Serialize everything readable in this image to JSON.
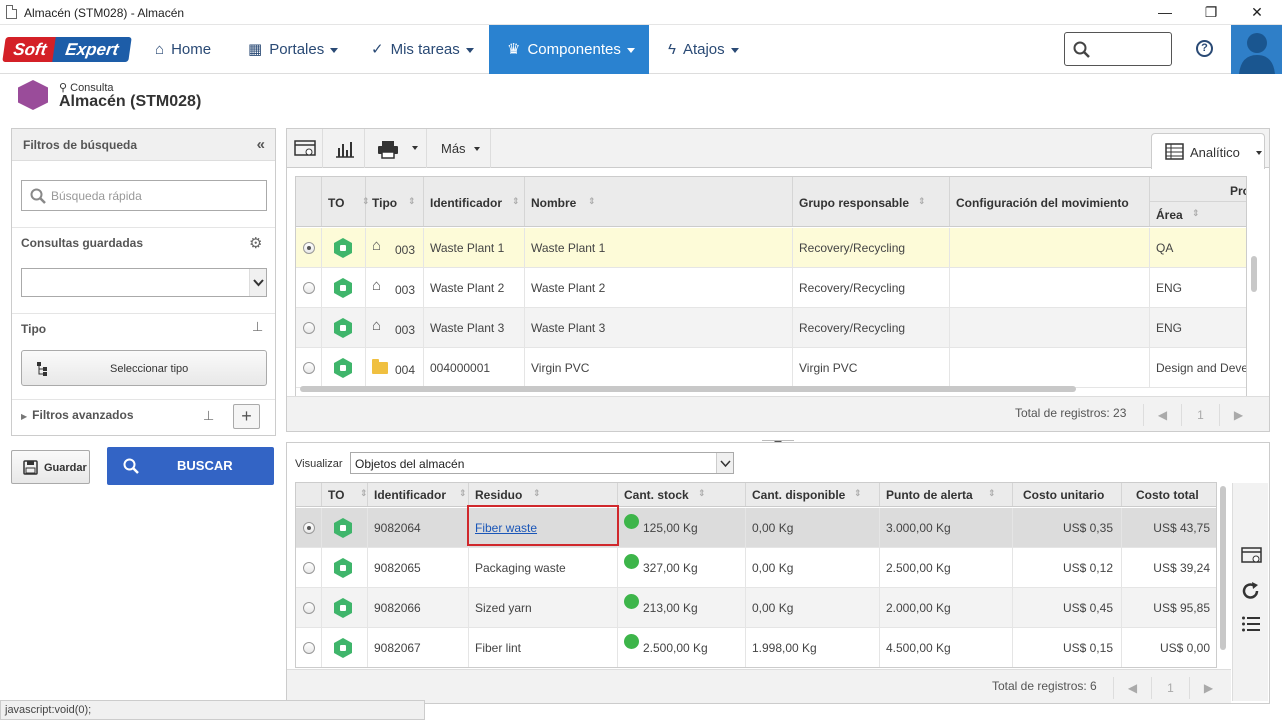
{
  "window": {
    "title": "Almacén (STM028) - Almacén",
    "min_glyph": "—",
    "max_glyph": "❐",
    "close_glyph": "✕"
  },
  "nav": {
    "logo_soft": "Soft",
    "logo_expert": "Expert",
    "items": [
      {
        "label": "Home",
        "icon": "home-icon"
      },
      {
        "label": "Portales",
        "icon": "grid-icon"
      },
      {
        "label": "Mis tareas",
        "icon": "check-icon"
      },
      {
        "label": "Componentes",
        "icon": "trophy-icon"
      },
      {
        "label": "Atajos",
        "icon": "bolt-icon"
      }
    ],
    "search_placeholder": "",
    "help_glyph": "?"
  },
  "page": {
    "subtitle": "Consulta",
    "title": "Almacén (STM028)"
  },
  "filters": {
    "header": "Filtros de búsqueda",
    "collapse_glyph": "«",
    "quick_search_placeholder": "Búsqueda rápida",
    "saved_label": "Consultas guardadas",
    "tipo_label": "Tipo",
    "select_tipo_label": "Seleccionar tipo",
    "advanced_label": "Filtros avanzados",
    "save_label": "Guardar",
    "search_label": "BUSCAR"
  },
  "top_toolbar": {
    "more_label": "Más",
    "view_label": "Analítico"
  },
  "top_grid": {
    "headers": {
      "to": "TO",
      "tipo": "Tipo",
      "id": "Identificador",
      "nombre": "Nombre",
      "grupo": "Grupo responsable",
      "config": "Configuración del movimiento",
      "pro": "Pro",
      "area": "Área"
    },
    "rows": [
      {
        "tipo": "003",
        "id": "Waste Plant 1",
        "nombre": "Waste Plant 1",
        "grupo": "Recovery/Recycling",
        "config": "",
        "area": "QA",
        "icon": "house"
      },
      {
        "tipo": "003",
        "id": "Waste Plant 2",
        "nombre": "Waste Plant 2",
        "grupo": "Recovery/Recycling",
        "config": "",
        "area": "ENG",
        "icon": "house"
      },
      {
        "tipo": "003",
        "id": "Waste Plant 3",
        "nombre": "Waste Plant 3",
        "grupo": "Recovery/Recycling",
        "config": "",
        "area": "ENG",
        "icon": "house"
      },
      {
        "tipo": "004",
        "id": "004000001",
        "nombre": "Virgin PVC",
        "grupo": "Virgin PVC",
        "config": "",
        "area": "Design and Deve",
        "icon": "folder"
      }
    ],
    "total": "Total de registros: 23",
    "page": "1"
  },
  "bottom": {
    "visualizar_label": "Visualizar",
    "visualizar_value": "Objetos del almacén",
    "headers": {
      "to": "TO",
      "id": "Identificador",
      "residuo": "Residuo",
      "stock": "Cant. stock",
      "disp": "Cant. disponible",
      "alerta": "Punto de alerta",
      "costo_u": "Costo unitario",
      "costo_t": "Costo total"
    },
    "rows": [
      {
        "id": "9082064",
        "residuo": "Fiber waste",
        "stock": "125,00 Kg",
        "disp": "0,00 Kg",
        "alerta": "3.000,00 Kg",
        "costo_u": "US$ 0,35",
        "costo_t": "US$ 43,75"
      },
      {
        "id": "9082065",
        "residuo": "Packaging waste",
        "stock": "327,00 Kg",
        "disp": "0,00 Kg",
        "alerta": "2.500,00 Kg",
        "costo_u": "US$ 0,12",
        "costo_t": "US$ 39,24"
      },
      {
        "id": "9082066",
        "residuo": "Sized yarn",
        "stock": "213,00 Kg",
        "disp": "0,00 Kg",
        "alerta": "2.000,00 Kg",
        "costo_u": "US$ 0,45",
        "costo_t": "US$ 95,85"
      },
      {
        "id": "9082067",
        "residuo": "Fiber lint",
        "stock": "2.500,00 Kg",
        "disp": "1.998,00 Kg",
        "alerta": "4.500,00 Kg",
        "costo_u": "US$ 0,15",
        "costo_t": "US$ 0,00"
      }
    ],
    "total": "Total de registros: 6",
    "page": "1"
  },
  "status_bar": "javascript:void(0);",
  "colors": {
    "accent": "#2a82d0",
    "buscar": "#3364c5",
    "selected_row": "#fdfbd8",
    "highlight": "#d0282c"
  }
}
